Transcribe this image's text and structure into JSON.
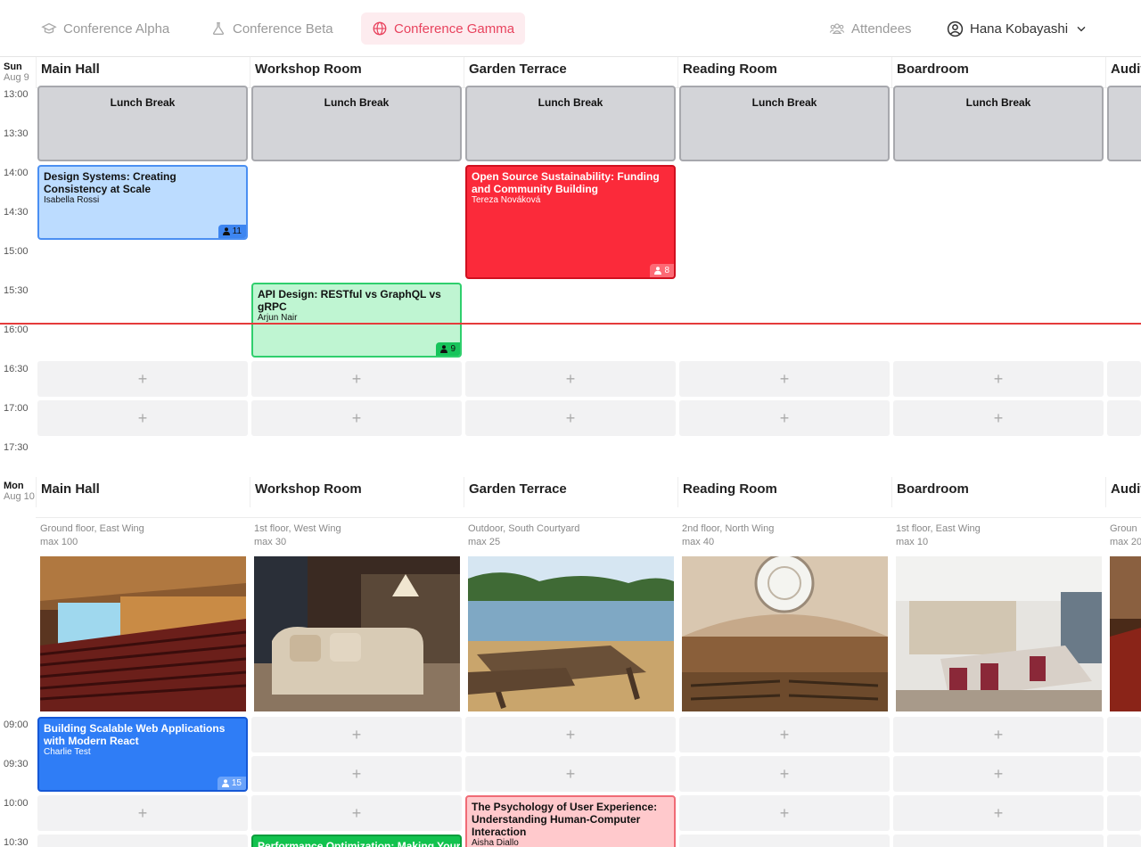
{
  "nav": {
    "tabs": [
      {
        "label": "Conference Alpha",
        "icon": "graduation-cap-icon"
      },
      {
        "label": "Conference Beta",
        "icon": "flask-icon"
      },
      {
        "label": "Conference Gamma",
        "icon": "globe-icon",
        "active": true
      }
    ],
    "attendees_label": "Attendees",
    "user_name": "Hana Kobayashi"
  },
  "days": [
    {
      "weekday": "Sun",
      "date": "Aug 9"
    },
    {
      "weekday": "Mon",
      "date": "Aug 10"
    }
  ],
  "rooms": [
    {
      "name": "Main Hall",
      "location": "Ground floor, East Wing",
      "capacity": "max 100"
    },
    {
      "name": "Workshop Room",
      "location": "1st floor, West Wing",
      "capacity": "max 30"
    },
    {
      "name": "Garden Terrace",
      "location": "Outdoor, South Courtyard",
      "capacity": "max 25"
    },
    {
      "name": "Reading Room",
      "location": "2nd floor, North Wing",
      "capacity": "max 40"
    },
    {
      "name": "Boardroom",
      "location": "1st floor, East Wing",
      "capacity": "max 10"
    },
    {
      "name": "Audit",
      "location": "Groun",
      "capacity": "max 20"
    }
  ],
  "sun_times": [
    "13:00",
    "13:30",
    "14:00",
    "14:30",
    "15:00",
    "15:30",
    "16:00",
    "16:30",
    "17:00",
    "17:30"
  ],
  "mon_times": [
    "09:00",
    "09:30",
    "10:00",
    "10:30"
  ],
  "lunch_label": "Lunch Break",
  "add_symbol": "+",
  "events": {
    "design_systems": {
      "title": "Design Systems: Creating Consistency at Scale",
      "speaker": "Isabella Rossi",
      "count": "11"
    },
    "open_source": {
      "title": "Open Source Sustainability: Funding and Community Building",
      "speaker": "Tereza Nováková",
      "count": "8"
    },
    "api_design": {
      "title": "API Design: RESTful vs GraphQL vs gRPC",
      "speaker": "Arjun Nair",
      "count": "9"
    },
    "scalable_web": {
      "title": "Building Scalable Web Applications with Modern React",
      "speaker": "Charlie Test",
      "count": "15"
    },
    "psychology_ux": {
      "title": "The Psychology of User Experience: Understanding Human-Computer Interaction",
      "speaker": "Aisha Diallo"
    },
    "performance": {
      "title": "Performance Optimization: Making Your"
    }
  },
  "colors": {
    "accent": "#e8435e",
    "now_line": "#e53b3b"
  }
}
